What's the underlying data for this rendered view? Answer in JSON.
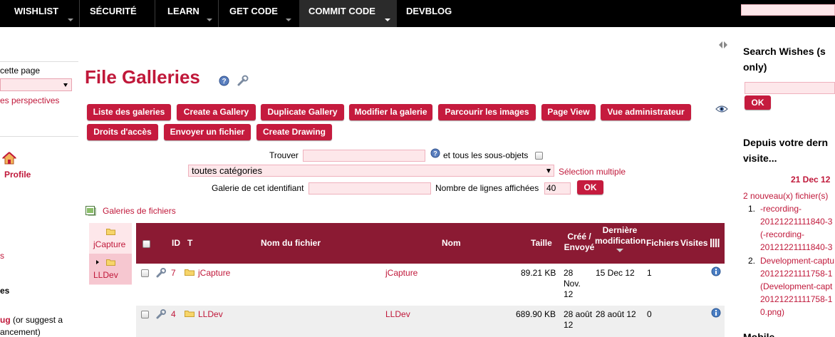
{
  "topnav": {
    "items": [
      {
        "label": "WISHLIST"
      },
      {
        "label": "SÉCURITÉ"
      },
      {
        "label": "LEARN"
      },
      {
        "label": "GET CODE"
      },
      {
        "label": "COMMIT CODE"
      },
      {
        "label": "DEVBLOG"
      }
    ]
  },
  "left": {
    "page_label": "cette page",
    "perspectives_link": "es perspectives",
    "profile_link": "Profile",
    "s_link": "s",
    "es_text": "es",
    "bug_link": "ug",
    "bug_suffix": " (or suggest a",
    "enhancement_text": "ancement)"
  },
  "main": {
    "title": "File Galleries",
    "buttons": {
      "list_galleries": "Liste des galeries",
      "create_gallery": "Create a Gallery",
      "duplicate_gallery": "Duplicate Gallery",
      "edit_gallery": "Modifier la galerie",
      "browse_images": "Parcourir les images",
      "page_view": "Page View",
      "admin_view": "Vue administrateur",
      "access_rights": "Droits d'accès",
      "upload_file": "Envoyer un fichier",
      "create_drawing": "Create Drawing"
    },
    "find_label": "Trouver",
    "subobjects_label": "et tous les sous-objets",
    "category_select": "toutes catégories",
    "multi_select_link": "Sélection multiple",
    "gallery_id_label": "Galerie de cet identifiant",
    "rows_label": "Nombre de lignes affichées",
    "rows_value": "40",
    "ok_label": "OK",
    "galleries_link": "Galeries de fichiers"
  },
  "tree": {
    "nodes": [
      {
        "label": "jCapture"
      },
      {
        "label": "LLDev"
      }
    ]
  },
  "table": {
    "headers": {
      "id": "ID",
      "t": "T",
      "filename": "Nom du fichier",
      "name": "Nom",
      "size": "Taille",
      "created_1": "Créé /",
      "created_2": "Envoyé",
      "modified_1": "Dernière",
      "modified_2": "modification",
      "files": "Fichiers",
      "visits": "Visites"
    },
    "rows": [
      {
        "id": "7",
        "filename": "jCapture",
        "name": "jCapture",
        "size": "89.21 KB",
        "created_1": "28",
        "created_2": "Nov.",
        "created_3": "12",
        "modified": "15 Dec 12",
        "files": "1"
      },
      {
        "id": "4",
        "filename": "LLDev",
        "name": "LLDev",
        "size": "689.90 KB",
        "created_1": "28 août",
        "created_2": "12",
        "modified": "28 août 12",
        "files": "0"
      }
    ]
  },
  "right": {
    "search_title_1": "Search Wishes (s",
    "search_title_2": "only)",
    "ok_label": "OK",
    "since_title_1": "Depuis votre dern",
    "since_title_2": "visite...",
    "date": "21 Dec 12",
    "new_files": "2 nouveau(x) fichier(s)",
    "items": [
      {
        "num": "1.",
        "l1": "-recording-",
        "l2": "20121221111840-3",
        "l3": "(-recording-",
        "l4": "20121221111840-3"
      },
      {
        "num": "2.",
        "l1": "Development-captu",
        "l2": "20121221111758-1",
        "l3": "(Development-capt",
        "l4": "20121221111758-1",
        "l5": "0.png)"
      }
    ],
    "mobile_title": "Mobile"
  },
  "colors": {
    "brand": "#c0183a",
    "button": "#c51b3e",
    "table_header": "#8b1a33",
    "input_bg": "#fde7ea"
  }
}
